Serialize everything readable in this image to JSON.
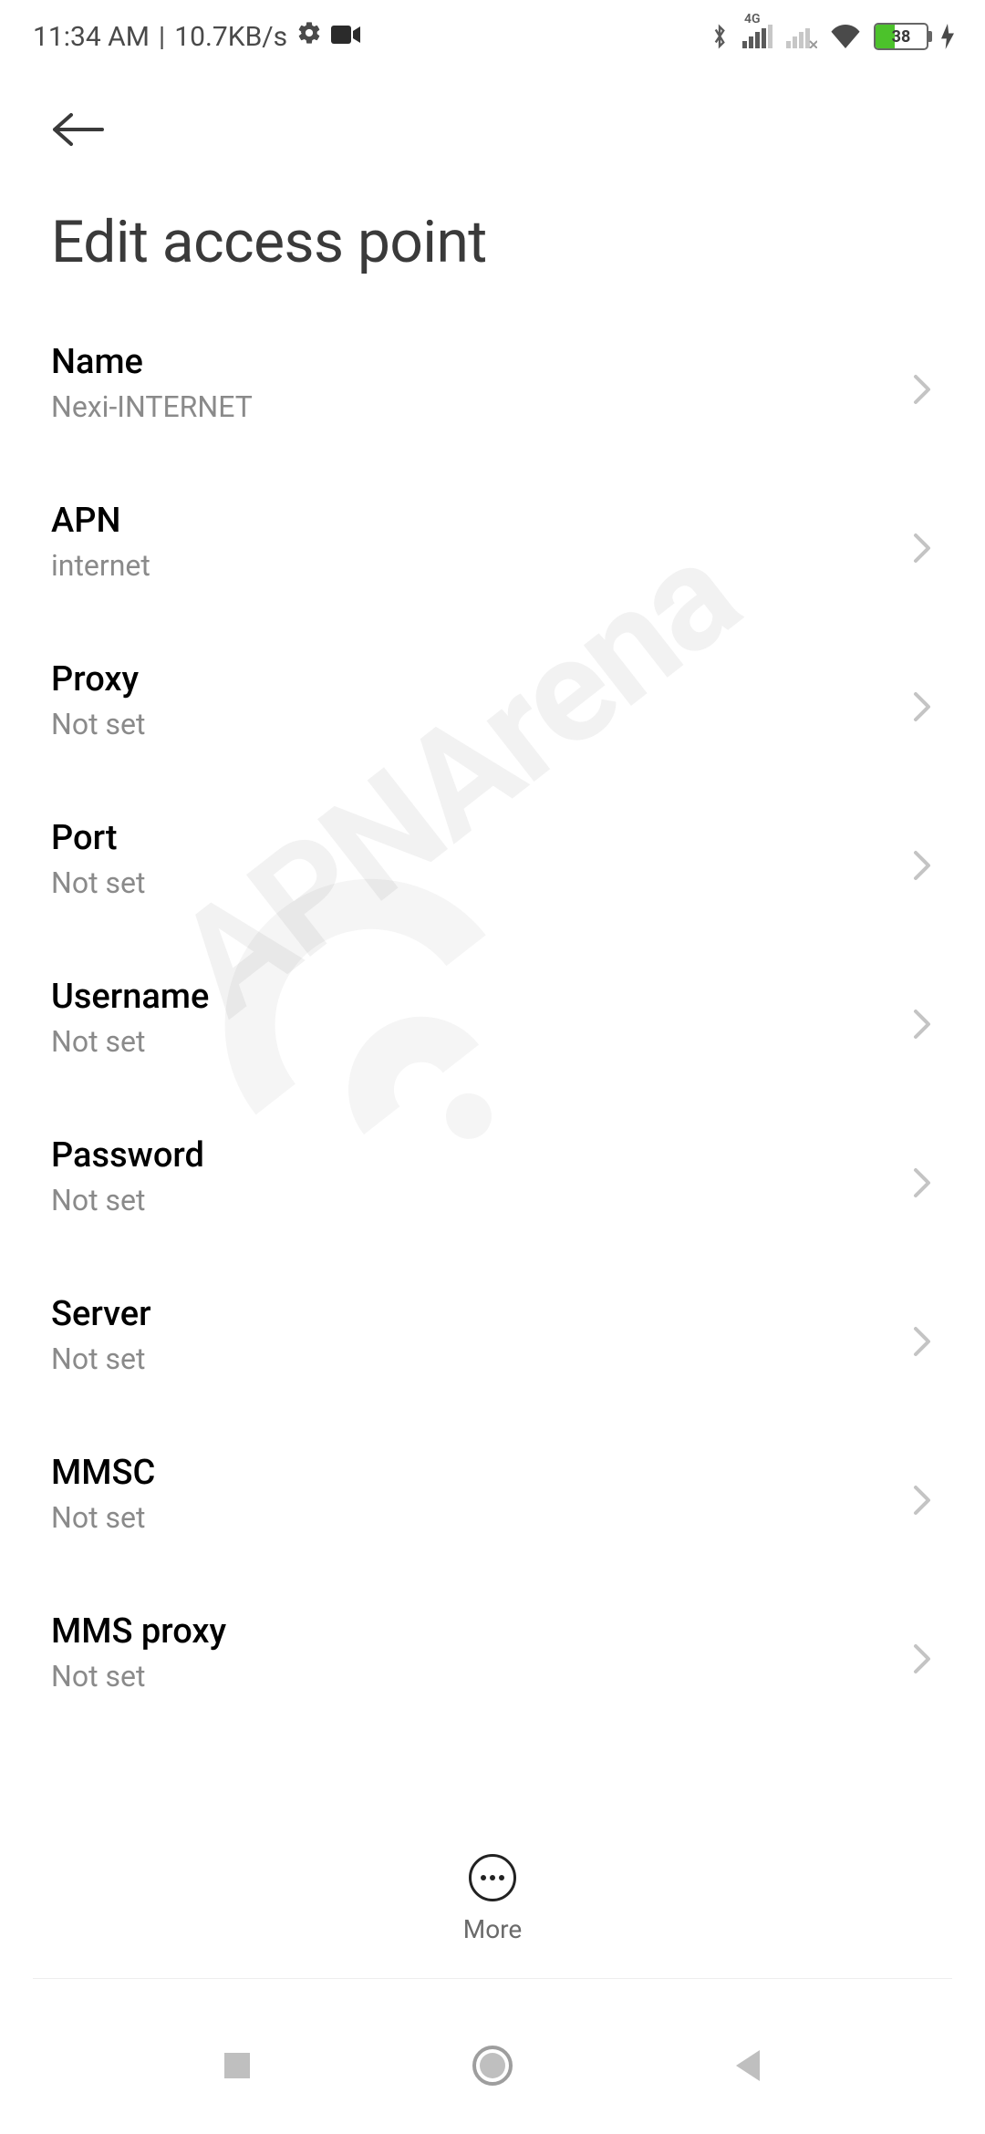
{
  "statusbar": {
    "time": "11:34 AM",
    "separator": "|",
    "network_speed": "10.7KB/s",
    "battery_percent": "38",
    "battery_fill_pct": 38
  },
  "header": {
    "title": "Edit access point"
  },
  "settings": [
    {
      "label": "Name",
      "value": "Nexi-INTERNET",
      "id": "name"
    },
    {
      "label": "APN",
      "value": "internet",
      "id": "apn"
    },
    {
      "label": "Proxy",
      "value": "Not set",
      "id": "proxy"
    },
    {
      "label": "Port",
      "value": "Not set",
      "id": "port"
    },
    {
      "label": "Username",
      "value": "Not set",
      "id": "username"
    },
    {
      "label": "Password",
      "value": "Not set",
      "id": "password"
    },
    {
      "label": "Server",
      "value": "Not set",
      "id": "server"
    },
    {
      "label": "MMSC",
      "value": "Not set",
      "id": "mmsc"
    },
    {
      "label": "MMS proxy",
      "value": "Not set",
      "id": "mms-proxy"
    }
  ],
  "bottom_action": {
    "label": "More"
  },
  "watermark": "APNArena"
}
